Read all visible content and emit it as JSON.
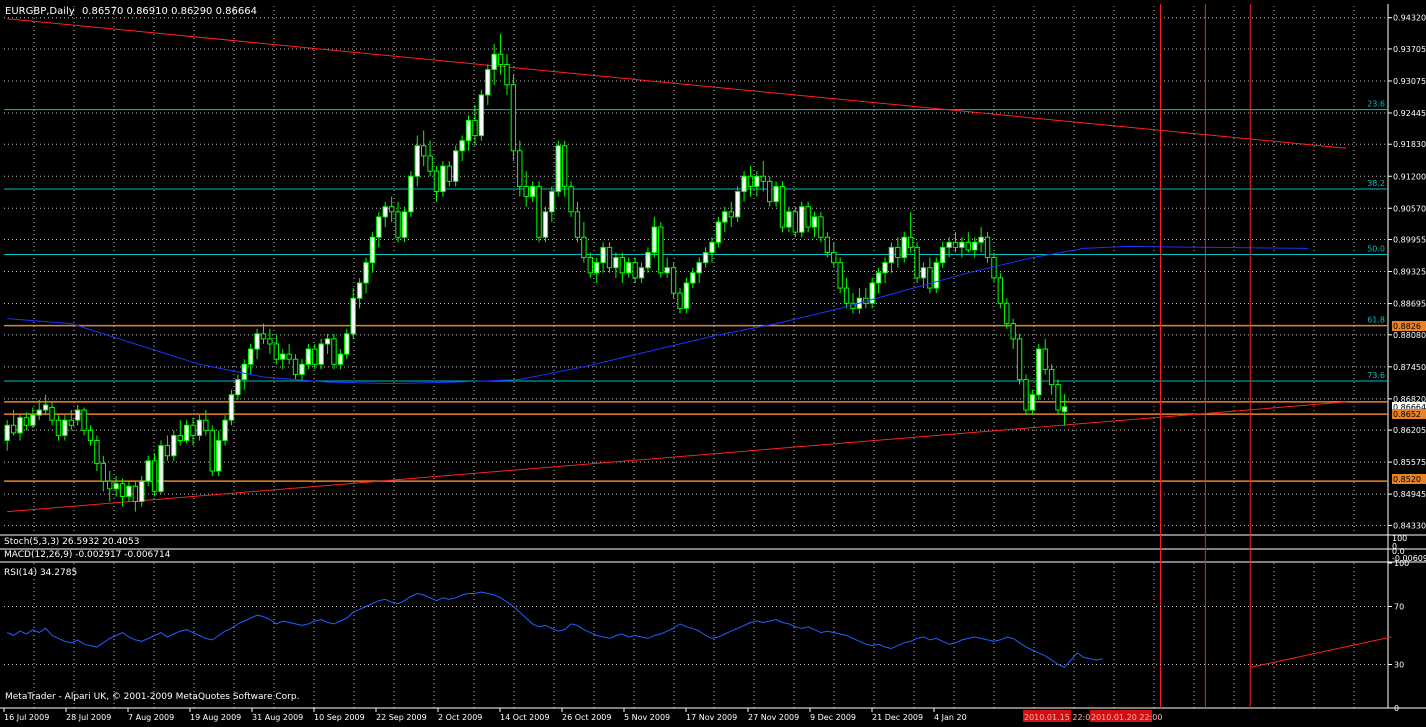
{
  "header": {
    "symbol": "EURGBP,Daily",
    "ohlc": "0.86570 0.86910 0.86290 0.86664"
  },
  "colors": {
    "background": "#000000",
    "bull_fill": "#ffffff",
    "bull_edge": "#00ff00",
    "bear_fill": "#000000",
    "bear_edge": "#00ff00",
    "grid": "#c0c0c0",
    "axis_text": "#ffffff",
    "fib_lines": "#00c0c0",
    "fib_text": "#00c0c0",
    "trendline": "#ff2020",
    "moving_average": "#2030ff",
    "hline": "#e8822a",
    "vline": "#ff2020",
    "rsi": "#2060ff",
    "current_price_box": "#ffffff",
    "price_box": "#e8822a"
  },
  "main_panel": {
    "price_ticks": [
      "0.94320",
      "0.93705",
      "0.93075",
      "0.92445",
      "0.91830",
      "0.91200",
      "0.90570",
      "0.89955",
      "0.89325",
      "0.88695",
      "0.88080",
      "0.87450",
      "0.86820",
      "0.86205",
      "0.85575",
      "0.84945",
      "0.84330"
    ],
    "price_range": [
      0.842,
      0.9455
    ],
    "current_price": "0.86664",
    "price_label_1": "0.8826",
    "price_label_2": "0.8652",
    "price_label_3": "0.8520",
    "fib_levels": [
      {
        "label": "23.6",
        "price": 0.9251
      },
      {
        "label": "38.2",
        "price": 0.9095
      },
      {
        "label": "50.0",
        "price": 0.8966
      },
      {
        "label": "61.8",
        "price": 0.8826
      },
      {
        "label": "73.6",
        "price": 0.8717
      }
    ],
    "horizontal_lines": [
      0.8826,
      0.8676,
      0.8652,
      0.852
    ],
    "trendlines": [
      {
        "from": [
          0,
          0.943
        ],
        "to": [
          209,
          0.9175
        ]
      },
      {
        "from": [
          0,
          0.846
        ],
        "to": [
          209,
          0.8676
        ]
      }
    ],
    "vertical_line_bars": [
      180,
      187,
      194
    ],
    "candles": [
      [
        0.86,
        0.864,
        0.858,
        0.863
      ],
      [
        0.863,
        0.866,
        0.861,
        0.8615
      ],
      [
        0.8615,
        0.865,
        0.86,
        0.8645
      ],
      [
        0.8645,
        0.8655,
        0.862,
        0.863
      ],
      [
        0.863,
        0.8665,
        0.8625,
        0.865
      ],
      [
        0.865,
        0.868,
        0.864,
        0.866
      ],
      [
        0.866,
        0.869,
        0.865,
        0.867
      ],
      [
        0.8665,
        0.8675,
        0.863,
        0.864
      ],
      [
        0.864,
        0.865,
        0.86,
        0.861
      ],
      [
        0.861,
        0.865,
        0.86,
        0.864
      ],
      [
        0.864,
        0.866,
        0.862,
        0.863
      ],
      [
        0.864,
        0.867,
        0.863,
        0.866
      ],
      [
        0.866,
        0.8665,
        0.861,
        0.862
      ],
      [
        0.862,
        0.863,
        0.859,
        0.86
      ],
      [
        0.86,
        0.861,
        0.854,
        0.8555
      ],
      [
        0.8555,
        0.857,
        0.85,
        0.852
      ],
      [
        0.852,
        0.854,
        0.848,
        0.8505
      ],
      [
        0.8505,
        0.853,
        0.849,
        0.8515
      ],
      [
        0.8515,
        0.8525,
        0.847,
        0.849
      ],
      [
        0.849,
        0.852,
        0.848,
        0.851
      ],
      [
        0.851,
        0.852,
        0.846,
        0.848
      ],
      [
        0.848,
        0.853,
        0.847,
        0.852
      ],
      [
        0.852,
        0.857,
        0.851,
        0.856
      ],
      [
        0.856,
        0.8575,
        0.849,
        0.85
      ],
      [
        0.85,
        0.86,
        0.8495,
        0.859
      ],
      [
        0.859,
        0.861,
        0.856,
        0.857
      ],
      [
        0.857,
        0.862,
        0.856,
        0.861
      ],
      [
        0.861,
        0.864,
        0.859,
        0.86
      ],
      [
        0.86,
        0.864,
        0.8595,
        0.863
      ],
      [
        0.863,
        0.8645,
        0.859,
        0.861
      ],
      [
        0.861,
        0.865,
        0.86,
        0.864
      ],
      [
        0.864,
        0.866,
        0.861,
        0.862
      ],
      [
        0.862,
        0.863,
        0.853,
        0.854
      ],
      [
        0.854,
        0.862,
        0.853,
        0.86
      ],
      [
        0.86,
        0.865,
        0.859,
        0.864
      ],
      [
        0.864,
        0.87,
        0.863,
        0.869
      ],
      [
        0.869,
        0.873,
        0.868,
        0.872
      ],
      [
        0.872,
        0.876,
        0.87,
        0.875
      ],
      [
        0.875,
        0.879,
        0.873,
        0.878
      ],
      [
        0.878,
        0.882,
        0.876,
        0.881
      ],
      [
        0.881,
        0.883,
        0.879,
        0.88
      ],
      [
        0.88,
        0.882,
        0.877,
        0.879
      ],
      [
        0.879,
        0.881,
        0.875,
        0.876
      ],
      [
        0.876,
        0.878,
        0.874,
        0.877
      ],
      [
        0.877,
        0.879,
        0.875,
        0.876
      ],
      [
        0.876,
        0.877,
        0.872,
        0.873
      ],
      [
        0.873,
        0.876,
        0.872,
        0.875
      ],
      [
        0.875,
        0.879,
        0.874,
        0.878
      ],
      [
        0.878,
        0.879,
        0.874,
        0.875
      ],
      [
        0.875,
        0.88,
        0.874,
        0.879
      ],
      [
        0.879,
        0.881,
        0.877,
        0.88
      ],
      [
        0.88,
        0.881,
        0.874,
        0.875
      ],
      [
        0.875,
        0.878,
        0.874,
        0.877
      ],
      [
        0.877,
        0.882,
        0.876,
        0.881
      ],
      [
        0.881,
        0.89,
        0.88,
        0.888
      ],
      [
        0.888,
        0.892,
        0.886,
        0.891
      ],
      [
        0.891,
        0.896,
        0.889,
        0.895
      ],
      [
        0.895,
        0.901,
        0.893,
        0.9
      ],
      [
        0.9,
        0.905,
        0.898,
        0.904
      ],
      [
        0.904,
        0.907,
        0.902,
        0.906
      ],
      [
        0.906,
        0.908,
        0.903,
        0.905
      ],
      [
        0.905,
        0.907,
        0.899,
        0.9
      ],
      [
        0.9,
        0.906,
        0.899,
        0.905
      ],
      [
        0.905,
        0.913,
        0.904,
        0.912
      ],
      [
        0.912,
        0.92,
        0.91,
        0.918
      ],
      [
        0.918,
        0.921,
        0.914,
        0.916
      ],
      [
        0.916,
        0.919,
        0.912,
        0.913
      ],
      [
        0.913,
        0.914,
        0.907,
        0.909
      ],
      [
        0.909,
        0.915,
        0.908,
        0.914
      ],
      [
        0.914,
        0.915,
        0.91,
        0.911
      ],
      [
        0.911,
        0.918,
        0.91,
        0.917
      ],
      [
        0.917,
        0.92,
        0.915,
        0.919
      ],
      [
        0.919,
        0.924,
        0.917,
        0.923
      ],
      [
        0.923,
        0.926,
        0.918,
        0.92
      ],
      [
        0.92,
        0.929,
        0.919,
        0.928
      ],
      [
        0.928,
        0.934,
        0.926,
        0.933
      ],
      [
        0.933,
        0.938,
        0.93,
        0.936
      ],
      [
        0.936,
        0.94,
        0.932,
        0.934
      ],
      [
        0.934,
        0.936,
        0.928,
        0.93
      ],
      [
        0.93,
        0.932,
        0.915,
        0.917
      ],
      [
        0.917,
        0.919,
        0.908,
        0.91
      ],
      [
        0.91,
        0.913,
        0.906,
        0.908
      ],
      [
        0.908,
        0.911,
        0.907,
        0.91
      ],
      [
        0.91,
        0.911,
        0.899,
        0.9
      ],
      [
        0.9,
        0.906,
        0.899,
        0.905
      ],
      [
        0.905,
        0.91,
        0.903,
        0.909
      ],
      [
        0.909,
        0.919,
        0.908,
        0.918
      ],
      [
        0.918,
        0.919,
        0.908,
        0.91
      ],
      [
        0.91,
        0.911,
        0.904,
        0.905
      ],
      [
        0.905,
        0.907,
        0.899,
        0.9
      ],
      [
        0.9,
        0.903,
        0.895,
        0.896
      ],
      [
        0.896,
        0.897,
        0.892,
        0.893
      ],
      [
        0.893,
        0.896,
        0.891,
        0.895
      ],
      [
        0.895,
        0.899,
        0.893,
        0.898
      ],
      [
        0.898,
        0.899,
        0.893,
        0.894
      ],
      [
        0.894,
        0.897,
        0.892,
        0.896
      ],
      [
        0.896,
        0.897,
        0.891,
        0.893
      ],
      [
        0.893,
        0.896,
        0.892,
        0.895
      ],
      [
        0.895,
        0.896,
        0.891,
        0.892
      ],
      [
        0.892,
        0.895,
        0.891,
        0.894
      ],
      [
        0.894,
        0.898,
        0.893,
        0.897
      ],
      [
        0.897,
        0.904,
        0.896,
        0.902
      ],
      [
        0.902,
        0.903,
        0.892,
        0.893
      ],
      [
        0.893,
        0.896,
        0.892,
        0.894
      ],
      [
        0.894,
        0.895,
        0.888,
        0.889
      ],
      [
        0.889,
        0.89,
        0.885,
        0.886
      ],
      [
        0.886,
        0.892,
        0.885,
        0.891
      ],
      [
        0.891,
        0.894,
        0.89,
        0.893
      ],
      [
        0.893,
        0.896,
        0.891,
        0.895
      ],
      [
        0.895,
        0.898,
        0.894,
        0.897
      ],
      [
        0.897,
        0.9,
        0.895,
        0.899
      ],
      [
        0.899,
        0.904,
        0.898,
        0.903
      ],
      [
        0.903,
        0.906,
        0.901,
        0.905
      ],
      [
        0.905,
        0.907,
        0.902,
        0.904
      ],
      [
        0.904,
        0.91,
        0.903,
        0.909
      ],
      [
        0.909,
        0.913,
        0.907,
        0.912
      ],
      [
        0.912,
        0.914,
        0.908,
        0.91
      ],
      [
        0.91,
        0.913,
        0.908,
        0.912
      ],
      [
        0.912,
        0.915,
        0.909,
        0.911
      ],
      [
        0.911,
        0.912,
        0.906,
        0.907
      ],
      [
        0.907,
        0.911,
        0.906,
        0.91
      ],
      [
        0.91,
        0.911,
        0.901,
        0.902
      ],
      [
        0.902,
        0.906,
        0.901,
        0.905
      ],
      [
        0.905,
        0.906,
        0.9,
        0.901
      ],
      [
        0.901,
        0.907,
        0.9,
        0.906
      ],
      [
        0.906,
        0.907,
        0.901,
        0.902
      ],
      [
        0.902,
        0.905,
        0.9,
        0.904
      ],
      [
        0.904,
        0.905,
        0.899,
        0.9
      ],
      [
        0.9,
        0.901,
        0.896,
        0.897
      ],
      [
        0.897,
        0.899,
        0.894,
        0.895
      ],
      [
        0.895,
        0.896,
        0.889,
        0.89
      ],
      [
        0.89,
        0.892,
        0.886,
        0.887
      ],
      [
        0.887,
        0.889,
        0.885,
        0.886
      ],
      [
        0.886,
        0.89,
        0.885,
        0.888
      ],
      [
        0.888,
        0.89,
        0.886,
        0.887
      ],
      [
        0.887,
        0.892,
        0.886,
        0.891
      ],
      [
        0.891,
        0.894,
        0.889,
        0.893
      ],
      [
        0.893,
        0.896,
        0.891,
        0.895
      ],
      [
        0.895,
        0.899,
        0.893,
        0.898
      ],
      [
        0.898,
        0.9,
        0.894,
        0.896
      ],
      [
        0.896,
        0.901,
        0.895,
        0.9
      ],
      [
        0.9,
        0.905,
        0.897,
        0.898
      ],
      [
        0.898,
        0.899,
        0.891,
        0.892
      ],
      [
        0.892,
        0.895,
        0.89,
        0.894
      ],
      [
        0.894,
        0.896,
        0.889,
        0.89
      ],
      [
        0.89,
        0.896,
        0.889,
        0.895
      ],
      [
        0.895,
        0.899,
        0.894,
        0.898
      ],
      [
        0.898,
        0.9,
        0.896,
        0.899
      ],
      [
        0.899,
        0.901,
        0.897,
        0.898
      ],
      [
        0.898,
        0.9,
        0.896,
        0.899
      ],
      [
        0.899,
        0.901,
        0.897,
        0.8975
      ],
      [
        0.8975,
        0.9,
        0.896,
        0.899
      ],
      [
        0.899,
        0.902,
        0.897,
        0.9
      ],
      [
        0.9,
        0.901,
        0.895,
        0.896
      ],
      [
        0.896,
        0.897,
        0.891,
        0.892
      ],
      [
        0.892,
        0.893,
        0.886,
        0.887
      ],
      [
        0.887,
        0.888,
        0.882,
        0.883
      ],
      [
        0.883,
        0.884,
        0.878,
        0.88
      ],
      [
        0.88,
        0.881,
        0.871,
        0.872
      ],
      [
        0.872,
        0.873,
        0.865,
        0.866
      ],
      [
        0.866,
        0.87,
        0.865,
        0.869
      ],
      [
        0.869,
        0.879,
        0.868,
        0.878
      ],
      [
        0.878,
        0.88,
        0.873,
        0.874
      ],
      [
        0.874,
        0.875,
        0.869,
        0.871
      ],
      [
        0.871,
        0.872,
        0.865,
        0.866
      ],
      [
        0.8657,
        0.8691,
        0.8629,
        0.86664
      ]
    ],
    "moving_average": [
      [
        0,
        0.884
      ],
      [
        10,
        0.883
      ],
      [
        20,
        0.879
      ],
      [
        30,
        0.875
      ],
      [
        40,
        0.8725
      ],
      [
        50,
        0.8715
      ],
      [
        60,
        0.8712
      ],
      [
        70,
        0.8715
      ],
      [
        80,
        0.872
      ],
      [
        90,
        0.8745
      ],
      [
        100,
        0.8775
      ],
      [
        110,
        0.8805
      ],
      [
        120,
        0.883
      ],
      [
        130,
        0.886
      ],
      [
        140,
        0.8895
      ],
      [
        150,
        0.893
      ],
      [
        160,
        0.896
      ],
      [
        168,
        0.8978
      ],
      [
        175,
        0.8982
      ],
      [
        188,
        0.898
      ],
      [
        203,
        0.8978
      ]
    ]
  },
  "stoch_panel": {
    "label": "Stoch(5,3,3) 26.5932 20.4053",
    "scale_top": "100",
    "scale_bottom": "0"
  },
  "macd_panel": {
    "label": "MACD(12,26,9) -0.002917 -0.006714",
    "scale_top": "0.0",
    "scale_bottom": "-0.00609"
  },
  "rsi_panel": {
    "label": "RSI(14) 34.2785",
    "ticks": [
      "100",
      "70",
      "30",
      "0"
    ],
    "values": [
      52,
      50,
      53,
      51,
      54,
      52,
      55,
      50,
      48,
      46,
      45,
      47,
      44,
      43,
      42,
      45,
      48,
      50,
      52,
      49,
      47,
      46,
      48,
      50,
      52,
      49,
      51,
      53,
      54,
      52,
      50,
      48,
      47,
      50,
      53,
      55,
      58,
      60,
      62,
      64,
      63,
      61,
      58,
      60,
      59,
      58,
      57,
      58,
      60,
      61,
      59,
      58,
      60,
      62,
      66,
      68,
      70,
      72,
      74,
      75,
      73,
      72,
      74,
      77,
      79,
      78,
      76,
      74,
      76,
      75,
      76,
      78,
      79,
      79,
      80,
      79,
      78,
      76,
      73,
      70,
      66,
      62,
      58,
      56,
      57,
      55,
      53,
      54,
      58,
      57,
      54,
      52,
      50,
      49,
      48,
      50,
      51,
      49,
      50,
      49,
      48,
      50,
      51,
      53,
      55,
      58,
      56,
      55,
      53,
      50,
      48,
      49,
      51,
      53,
      55,
      57,
      59,
      60,
      59,
      60,
      61,
      59,
      58,
      56,
      55,
      56,
      54,
      52,
      53,
      52,
      51,
      50,
      48,
      46,
      44,
      43,
      44,
      42,
      41,
      43,
      45,
      46,
      48,
      49,
      47,
      48,
      46,
      44,
      45,
      47,
      48,
      49,
      48,
      47,
      46,
      47,
      49,
      48,
      45,
      42,
      40,
      38,
      36,
      33,
      30,
      28,
      33,
      38,
      35,
      34,
      33,
      34
    ],
    "trendline": {
      "from": [
        194,
        28
      ],
      "to": [
        216,
        49
      ]
    }
  },
  "footer": {
    "copyright": "MetaTrader - Alpari UK, © 2001-2009 MetaQuotes Software Corp."
  },
  "time_axis": {
    "labels": [
      "16 Jul 2009",
      "28 Jul 2009",
      "7 Aug 2009",
      "19 Aug 2009",
      "31 Aug 2009",
      "10 Sep 2009",
      "22 Sep 2009",
      "2 Oct 2009",
      "14 Oct 2009",
      "26 Oct 2009",
      "5 Nov 2009",
      "17 Nov 2009",
      "27 Nov 2009",
      "9 Dec 2009",
      "21 Dec 2009",
      "4 Jan 20"
    ],
    "red_labels": [
      "2010.01.15 22:00",
      "2010.01.20 22:00"
    ]
  }
}
